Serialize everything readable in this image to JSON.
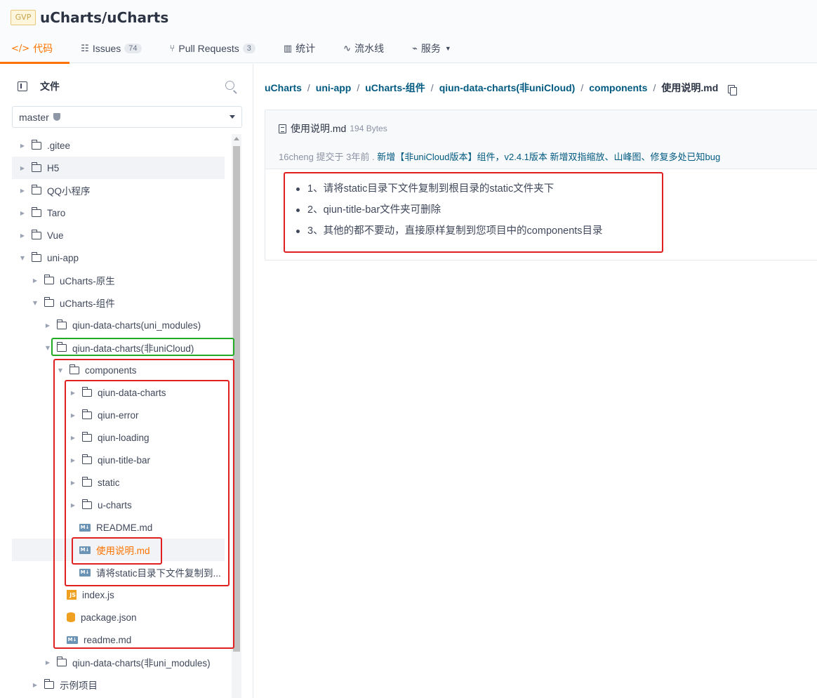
{
  "header": {
    "badge": "GVP",
    "repo": "uCharts/uCharts",
    "tabs": [
      {
        "icon": "</>",
        "label": "代码"
      },
      {
        "icon": "☷",
        "label": "Issues",
        "count": "74"
      },
      {
        "icon": "⑂",
        "label": "Pull Requests",
        "count": "3"
      },
      {
        "icon": "▥",
        "label": "统计"
      },
      {
        "icon": "∿",
        "label": "流水线"
      },
      {
        "icon": "⌁",
        "label": "服务"
      }
    ]
  },
  "sidebar": {
    "title": "文件",
    "branch": "master",
    "tree": [
      {
        "label": ".gitee",
        "type": "folder"
      },
      {
        "label": "H5",
        "type": "folder"
      },
      {
        "label": "QQ小程序",
        "type": "folder"
      },
      {
        "label": "Taro",
        "type": "folder"
      },
      {
        "label": "Vue",
        "type": "folder"
      },
      {
        "label": "uni-app",
        "type": "folder-open"
      },
      {
        "label": "uCharts-原生",
        "type": "folder"
      },
      {
        "label": "uCharts-组件",
        "type": "folder-open"
      },
      {
        "label": "qiun-data-charts(uni_modules)",
        "type": "folder"
      },
      {
        "label": "qiun-data-charts(非uniCloud)",
        "type": "folder-open"
      },
      {
        "label": "components",
        "type": "folder-open"
      },
      {
        "label": "qiun-data-charts",
        "type": "folder"
      },
      {
        "label": "qiun-error",
        "type": "folder"
      },
      {
        "label": "qiun-loading",
        "type": "folder"
      },
      {
        "label": "qiun-title-bar",
        "type": "folder"
      },
      {
        "label": "static",
        "type": "folder"
      },
      {
        "label": "u-charts",
        "type": "folder"
      },
      {
        "label": "README.md",
        "type": "md"
      },
      {
        "label": "使用说明.md",
        "type": "md"
      },
      {
        "label": "请将static目录下文件复制到...",
        "type": "md"
      },
      {
        "label": "index.js",
        "type": "js"
      },
      {
        "label": "package.json",
        "type": "json"
      },
      {
        "label": "readme.md",
        "type": "md"
      },
      {
        "label": "qiun-data-charts(非uni_modules)",
        "type": "folder"
      },
      {
        "label": "示例项目",
        "type": "folder"
      }
    ]
  },
  "breadcrumb": {
    "items": [
      "uCharts",
      "uni-app",
      "uCharts-组件",
      "qiun-data-charts(非uniCloud)",
      "components"
    ],
    "current": "使用说明.md"
  },
  "file": {
    "name": "使用说明.md",
    "size": "194 Bytes",
    "commit_author": "16cheng 提交于 3年前 .",
    "commit_message": "新增【非uniCloud版本】组件，v2.4.1版本 新增双指缩放、山峰图、修复多处已知bug"
  },
  "readme": [
    "1、请将static目录下文件复制到根目录的static文件夹下",
    "2、qiun-title-bar文件夹可删除",
    "3、其他的都不要动，直接原样复制到您项目中的components目录"
  ],
  "colors": {
    "accent": "#fe7300",
    "link": "#005980",
    "annotation_red": "#e02020",
    "annotation_green": "#22aa22"
  }
}
